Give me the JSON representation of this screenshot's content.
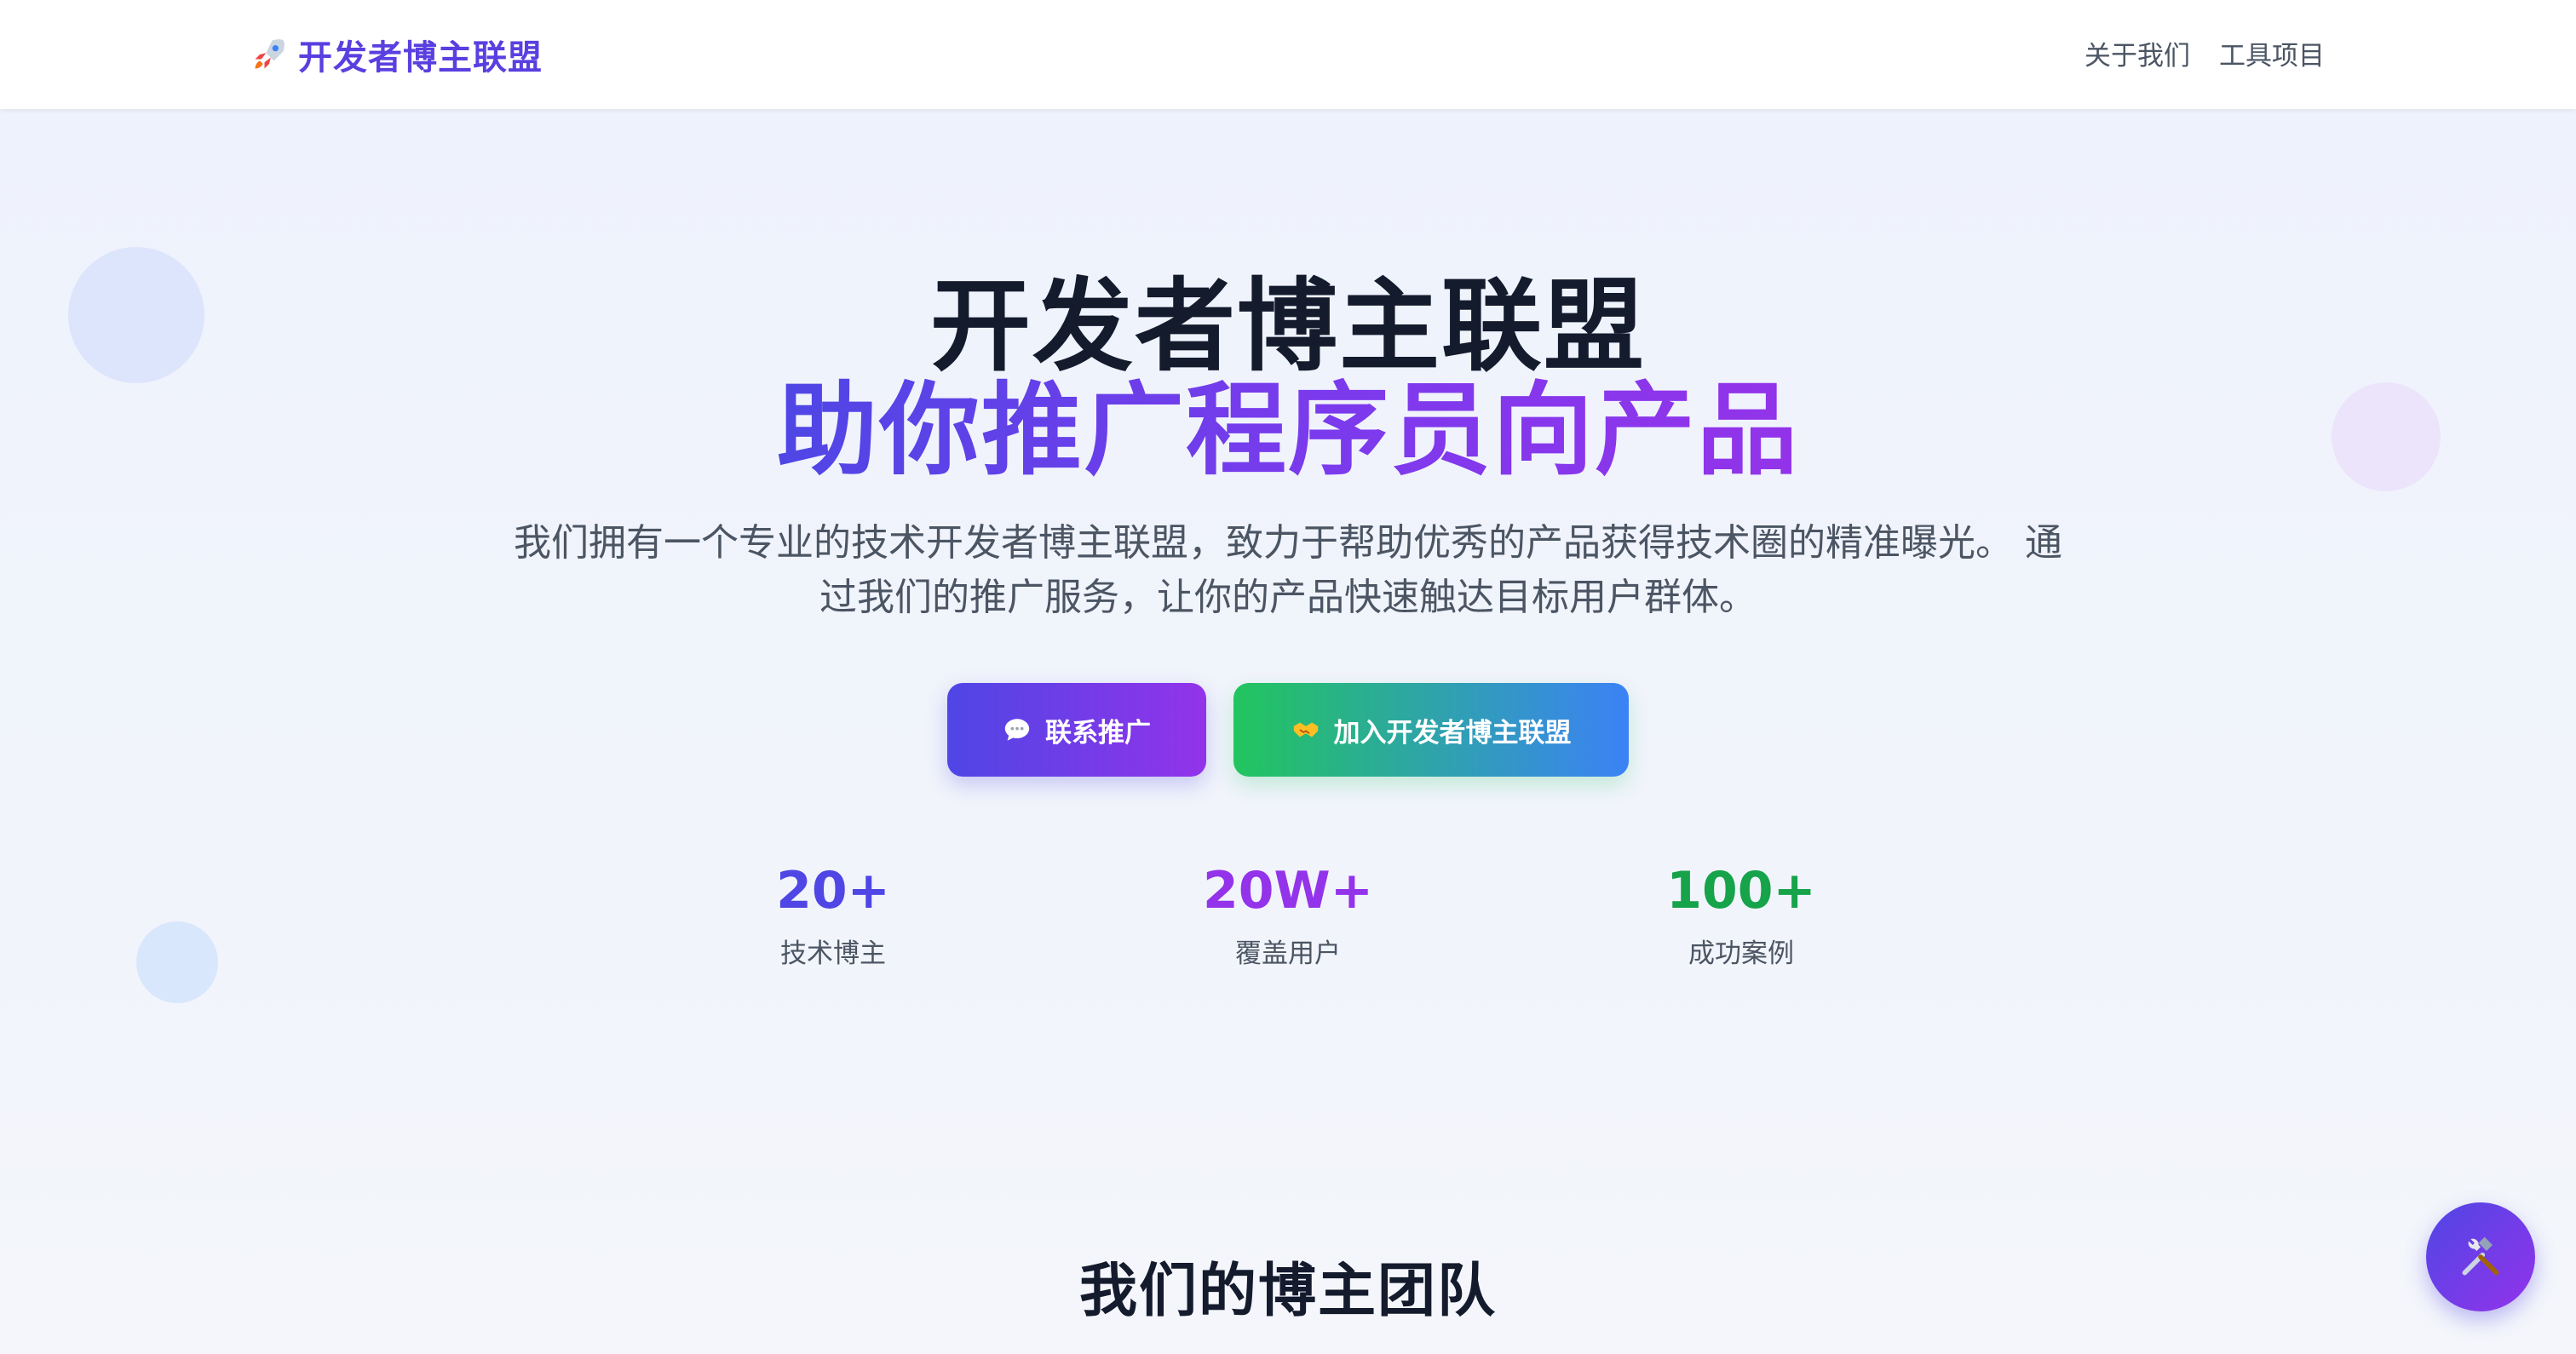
{
  "header": {
    "brand_icon": "rocket-icon",
    "brand_name": "开发者博主联盟",
    "nav": [
      {
        "label": "关于我们"
      },
      {
        "label": "工具项目"
      }
    ]
  },
  "hero": {
    "title": "开发者博主联盟",
    "subtitle": "助你推广程序员向产品",
    "description": "我们拥有一个专业的技术开发者博主联盟，致力于帮助优秀的产品获得技术圈的精准曝光。 通过我们的推广服务，让你的产品快速触达目标用户群体。"
  },
  "buttons": {
    "contact": {
      "icon": "speech-bubble-icon",
      "label": "联系推广"
    },
    "join": {
      "icon": "handshake-icon",
      "label": "加入开发者博主联盟"
    }
  },
  "stats": [
    {
      "value": "20+",
      "label": "技术博主",
      "color": "#4f46e5"
    },
    {
      "value": "20W+",
      "label": "覆盖用户",
      "color": "#9333ea"
    },
    {
      "value": "100+",
      "label": "成功案例",
      "color": "#16a34a"
    }
  ],
  "team": {
    "title": "我们的博主团队"
  },
  "fab": {
    "icon": "hammer-wrench-icon"
  },
  "colors": {
    "brand": "#5a3fe0",
    "primary_gradient_start": "#4f46e5",
    "primary_gradient_end": "#9333ea",
    "join_gradient_start": "#22c55e",
    "join_gradient_end": "#3b82f6"
  }
}
